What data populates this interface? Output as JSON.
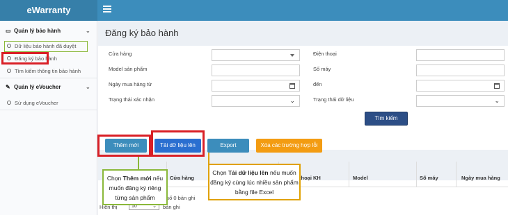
{
  "brand": "eWarranty",
  "sidebar": {
    "group1": "Quản lý bảo hành",
    "items1": [
      "Dữ liệu bảo hành đã duyệt",
      "Đăng ký bảo hành",
      "Tìm kiếm thông tin bảo hành"
    ],
    "group2": "Quản lý eVoucher",
    "items2": [
      "Sử dụng eVoucher"
    ]
  },
  "page_title": "Đăng ký bảo hành",
  "form": {
    "store": "Cửa hàng",
    "model": "Model sản phẩm",
    "buy_from": "Ngày mua hàng từ",
    "confirm_status": "Trạng thái xác nhận",
    "phone": "Điện thoại",
    "serial": "Số máy",
    "to": "đến",
    "data_status": "Trạng thái dữ liệu",
    "search": "Tìm kiếm"
  },
  "actions": {
    "add": "Thêm mới",
    "upload": "Tải dữ liệu lên",
    "export": "Export",
    "clear_errors": "Xóa các trường hợp lỗi"
  },
  "table": {
    "headers": [
      "Cửa hàng",
      "thoại KH",
      "Model",
      "Số máy",
      "Ngày mua hàng"
    ],
    "records": "ng số 0 bản ghi",
    "show_prefix": "Hiển thị",
    "page_size": "10",
    "show_suffix": "bản ghi"
  },
  "callouts": {
    "left_pre": "Chọn ",
    "left_bold": "Thêm mới",
    "left_post": " nếu muốn đăng ký riêng từng sản phẩm",
    "right_pre": "Chọn ",
    "right_bold": "Tải dữ liệu lên",
    "right_post": " nếu muốn đăng ký cùng lúc nhiều sản phẩm bằng file Excel"
  },
  "colors": {
    "topbar": "#3c8dbc",
    "highlight_red": "#d91f26",
    "callout_green": "#8ab83a",
    "callout_orange": "#e0a100"
  }
}
